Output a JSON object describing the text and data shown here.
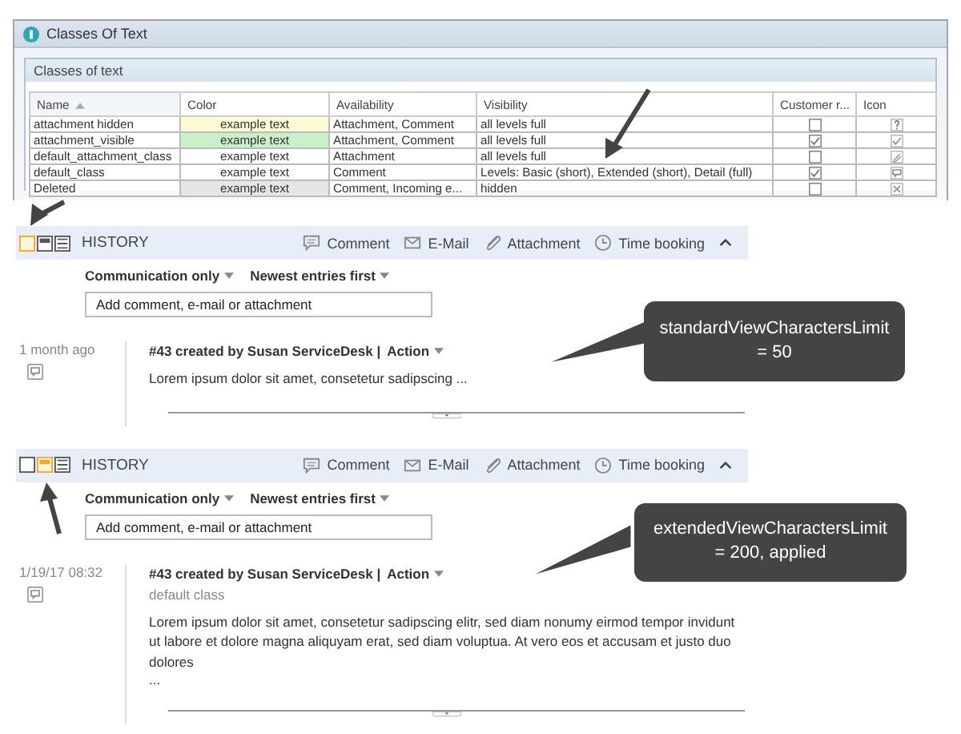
{
  "window": {
    "title": "Classes Of Text"
  },
  "panel": {
    "title": "Classes of text"
  },
  "table": {
    "columns": [
      {
        "label": "Name",
        "sorted": true
      },
      {
        "label": "Color",
        "sorted": false
      },
      {
        "label": "Availability",
        "sorted": false
      },
      {
        "label": "Visibility",
        "sorted": false
      },
      {
        "label": "Customer r...",
        "sorted": false
      },
      {
        "label": "Icon",
        "sorted": false
      }
    ],
    "rows": [
      {
        "name": "attachment hidden",
        "color": "#fffbd2",
        "example": "example text",
        "availability": "Attachment, Comment",
        "visibility": "all levels full",
        "customer_visible": false,
        "icon": {
          "kind": "question"
        }
      },
      {
        "name": "attachment_visible",
        "color": "#c9f0c9",
        "example": "example text",
        "availability": "Attachment, Comment",
        "visibility": "all levels full",
        "customer_visible": true,
        "icon": {
          "kind": "check"
        }
      },
      {
        "name": "default_attachment_class",
        "color": "#ffffff",
        "example": "example text",
        "availability": "Attachment",
        "visibility": "all levels full",
        "customer_visible": false,
        "icon": {
          "kind": "clip"
        }
      },
      {
        "name": "default_class",
        "color": "#ffffff",
        "example": "example text",
        "availability": "Comment",
        "visibility": "Levels: Basic (short), Extended (short), Detail (full)",
        "customer_visible": true,
        "icon": {
          "kind": "comment"
        }
      },
      {
        "name": "Deleted",
        "color": "#e6e6e6",
        "example": "example text",
        "availability": "Comment, Incoming e...",
        "visibility": "hidden",
        "customer_visible": false,
        "icon": {
          "kind": "cross"
        }
      }
    ]
  },
  "history_panels": [
    {
      "view_modes": [
        {
          "selected": true
        },
        {
          "selected": false
        },
        {
          "selected": false
        }
      ],
      "title": "HISTORY",
      "actions": [
        {
          "label": "Comment",
          "kind": "comment"
        },
        {
          "label": "E-Mail",
          "kind": "mail"
        },
        {
          "label": "Attachment",
          "kind": "clip"
        },
        {
          "label": "Time booking",
          "kind": "clock"
        }
      ],
      "filters": [
        "Communication only",
        "Newest entries first"
      ],
      "placeholder": "Add comment, e-mail or attachment",
      "entry": {
        "time": "1 month ago",
        "author": "#43 created by Susan ServiceDesk |",
        "action": "Action",
        "text": "Lorem ipsum dolor sit amet, consetetur sadipscing ..."
      },
      "callout": {
        "lines": [
          "standardViewCharactersLimit",
          "= 50"
        ]
      }
    },
    {
      "view_modes": [
        {
          "selected": false
        },
        {
          "selected": true
        },
        {
          "selected": false
        }
      ],
      "title": "HISTORY",
      "actions": [
        {
          "label": "Comment",
          "kind": "comment"
        },
        {
          "label": "E-Mail",
          "kind": "mail"
        },
        {
          "label": "Attachment",
          "kind": "clip"
        },
        {
          "label": "Time booking",
          "kind": "clock"
        }
      ],
      "filters": [
        "Communication only",
        "Newest entries first"
      ],
      "placeholder": "Add comment, e-mail or attachment",
      "entry": {
        "time": "1/19/17 08:32",
        "author": "#43 created by Susan ServiceDesk |",
        "action": "Action",
        "subtitle": "default class",
        "text": "Lorem ipsum dolor sit amet, consetetur sadipscing elitr, sed diam nonumy eirmod tempor invidunt ut labore et dolore magna aliquyam erat, sed diam voluptua. At vero eos et accusam et justo duo dolores",
        "more": "..."
      },
      "callout": {
        "lines": [
          "extendedViewCharactersLimit",
          "= 200, applied"
        ]
      }
    }
  ]
}
